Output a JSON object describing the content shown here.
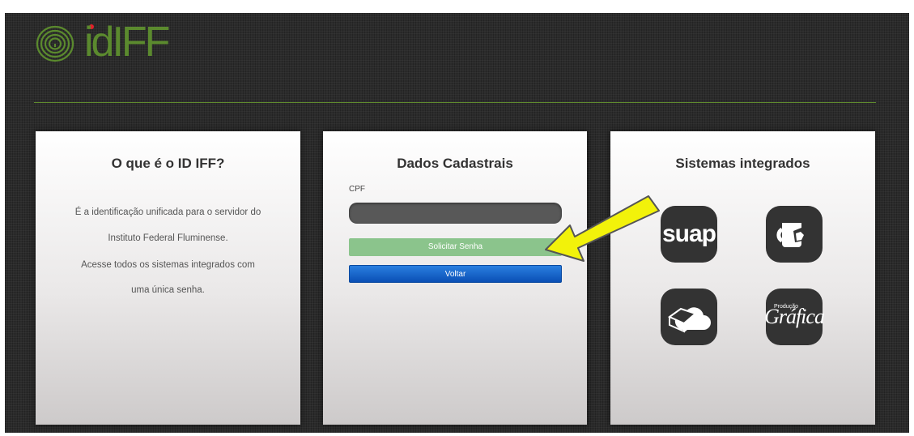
{
  "logo": {
    "text": "idIFF"
  },
  "card_about": {
    "title": "O que é o ID IFF?",
    "line1": "É a identificação unificada para o servidor do",
    "line2": "Instituto Federal Fluminense.",
    "line3": "Acesse todos os sistemas integrados com",
    "line4": "uma única senha."
  },
  "card_form": {
    "title": "Dados Cadastrais",
    "cpf_label": "CPF",
    "cpf_value": "",
    "submit_label": "Solicitar Senha",
    "back_label": "Voltar"
  },
  "card_systems": {
    "title": "Sistemas integrados",
    "suap_label": "suap",
    "grafica_small": "Produção",
    "grafica_label": "Gráfica"
  },
  "colors": {
    "accent_green": "#5b8a2e",
    "button_green": "#8bc48c",
    "button_blue": "#0a5fd1",
    "arrow": "#f2f20a"
  }
}
